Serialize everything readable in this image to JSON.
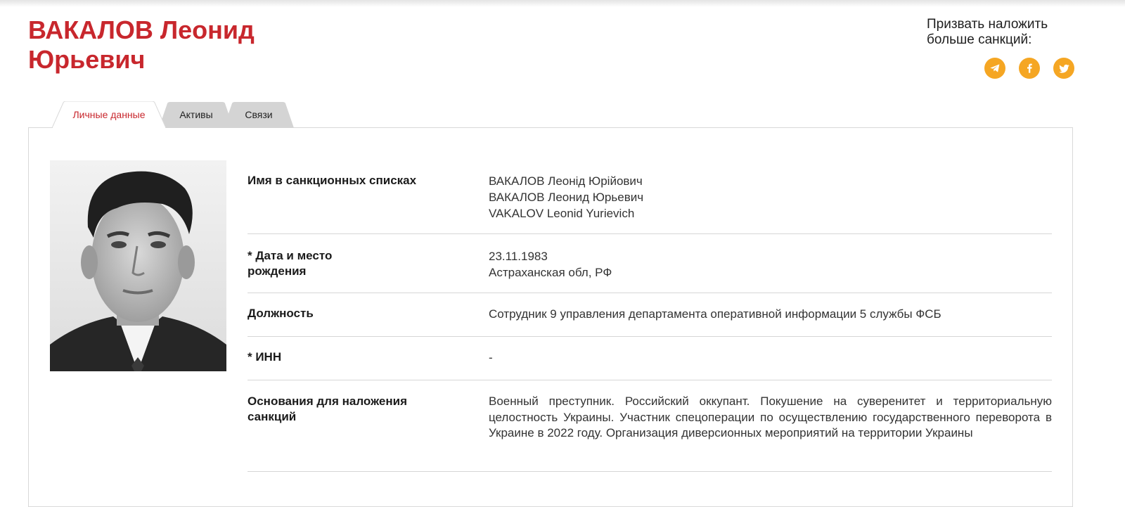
{
  "person": {
    "name_line1": "ВАКАЛОВ Леонид",
    "name_line2": "Юрьевич"
  },
  "share": {
    "label_line1": "Призвать наложить",
    "label_line2": "больше санкций:",
    "icons": [
      "telegram-icon",
      "facebook-icon",
      "twitter-icon"
    ],
    "icon_color": "#f5a623"
  },
  "tabs": [
    {
      "label": "Личные данные",
      "active": true
    },
    {
      "label": "Активы",
      "active": false
    },
    {
      "label": "Связи",
      "active": false
    }
  ],
  "colors": {
    "accent": "#c8272d",
    "tab_inactive": "#d4d4d4"
  },
  "details": {
    "sanction_names": {
      "label": "Имя в санкционных списках",
      "values": [
        "ВАКАЛОВ Леонід Юрійович",
        "ВАКАЛОВ Леонид Юрьевич",
        "VAKALOV Leonid Yurievich"
      ]
    },
    "birth": {
      "label_line1": "* Дата и место",
      "label_line2": "рождения",
      "date": "23.11.1983",
      "place": "Астраханская обл, РФ"
    },
    "position": {
      "label": "Должность",
      "value": "Сотрудник 9 управления департамента оперативной информации 5 службы ФСБ"
    },
    "inn": {
      "label": "* ИНН",
      "value": "-"
    },
    "grounds": {
      "label_line1": "Основания для наложения",
      "label_line2": "санкций",
      "value": "Военный преступник. Российский оккупант. Покушение на суверенитет и территориальную целостность Украины. Участник спецоперации по осуществлению государственного переворота в Украине в 2022 году. Организация диверсионных мероприятий на территории Украины"
    }
  }
}
